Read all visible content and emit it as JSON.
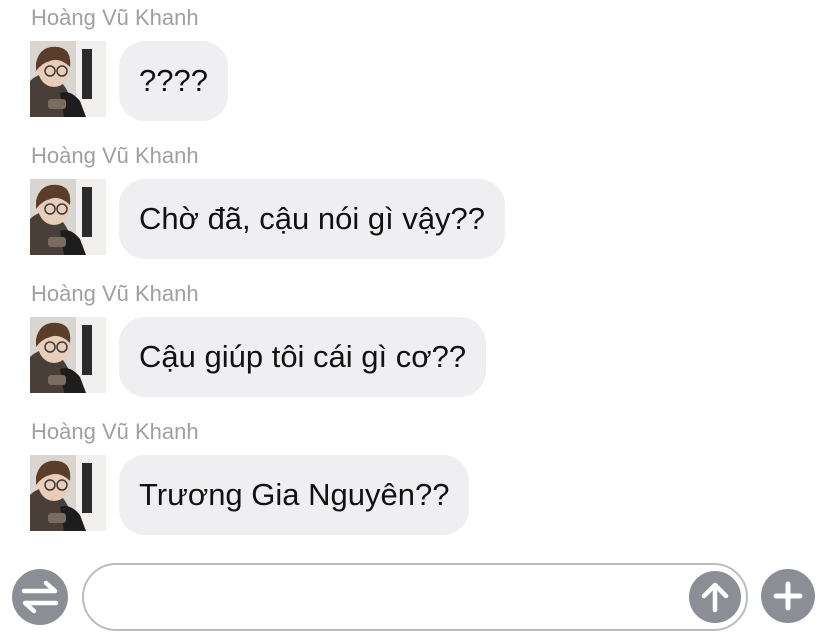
{
  "conversation": {
    "messages": [
      {
        "sender": "Hoàng Vũ Khanh",
        "text": "????"
      },
      {
        "sender": "Hoàng Vũ Khanh",
        "text": "Chờ đã, cậu nói gì vậy??"
      },
      {
        "sender": "Hoàng Vũ Khanh",
        "text": "Cậu giúp tôi cái gì cơ??"
      },
      {
        "sender": "Hoàng Vũ Khanh",
        "text": "Trương Gia Nguyên??"
      }
    ]
  },
  "composer": {
    "input_value": "",
    "swap_icon": "swap-arrows-icon",
    "send_icon": "arrow-up-icon",
    "add_icon": "plus-icon"
  },
  "colors": {
    "bubble_bg": "#efeff1",
    "sender_text": "#a0a0a0",
    "button_gray": "#8b8f95"
  }
}
